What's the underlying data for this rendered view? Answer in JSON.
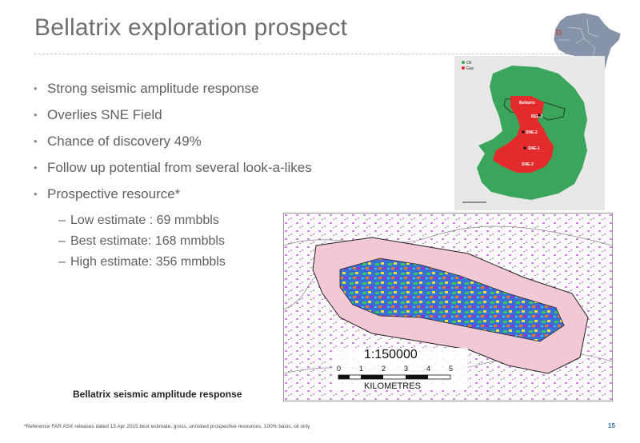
{
  "slide": {
    "title": "Bellatrix exploration prospect",
    "bullets": [
      "Strong seismic amplitude response",
      "Overlies SNE Field",
      "Chance of discovery 49%",
      "Follow up potential from several look-a-likes",
      "Prospective resource*"
    ],
    "sub_bullets": [
      "Low estimate : 69 mmbbls",
      "Best estimate: 168 mmbbls",
      "High estimate: 356 mmbbls"
    ],
    "map": {
      "legend": [
        "Oil",
        "Gas"
      ],
      "labels": [
        "Bellatrix",
        "BEL-1",
        "SNE-2",
        "SNE-1",
        "SNE-3"
      ],
      "colors": {
        "block": "#3aa65c",
        "prospect": "#e32b2b"
      }
    },
    "seismic": {
      "scale": "1:150000",
      "scale_ticks": [
        "0",
        "1",
        "2",
        "3",
        "4",
        "5"
      ],
      "units": "KILOMETRES",
      "caption": "Bellatrix seismic amplitude response"
    },
    "footnote": "*Reference FAR ASX releases dated 13 Apr 2015 best estimate, gross, unrisked prospective resources, 100% basis, oil only",
    "page_number": "15"
  }
}
